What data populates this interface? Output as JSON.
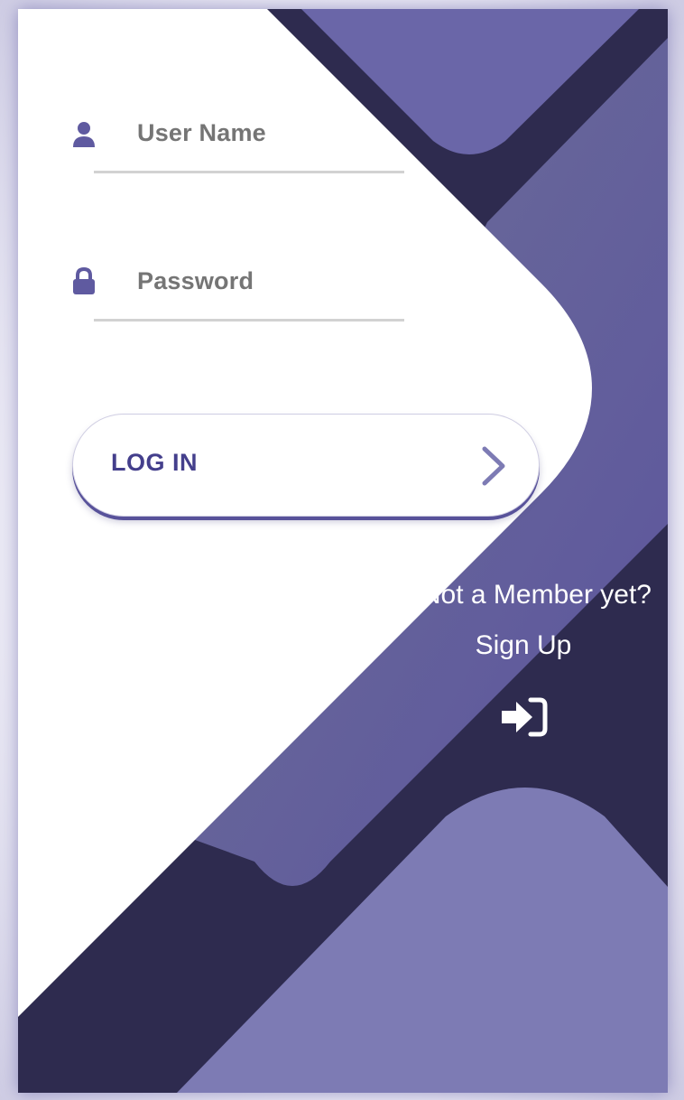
{
  "login_form": {
    "username_placeholder": "User Name",
    "password_placeholder": "Password",
    "login_label": "LOG IN"
  },
  "signup": {
    "prompt": "Not a Member yet?",
    "link_label": "Sign Up"
  },
  "icons": {
    "username": "user-icon",
    "password": "lock-icon",
    "login": "chevron-right-icon",
    "signup": "sign-in-icon"
  },
  "colors": {
    "dark_navy": "#2e2b4f",
    "purple": "#6a66a8",
    "light_purple": "#7d7bb4",
    "accent_text": "#443f8c",
    "placeholder_text": "#707070"
  }
}
